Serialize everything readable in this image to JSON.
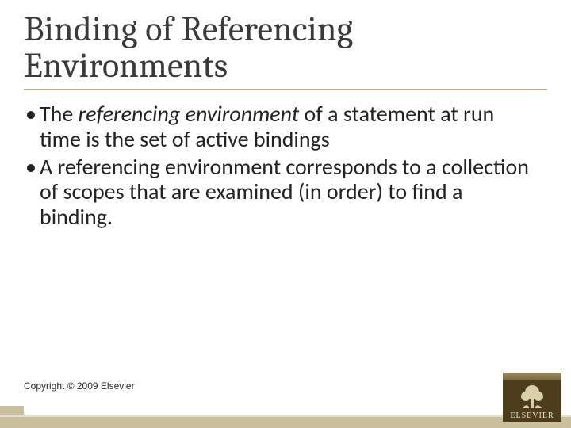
{
  "title": "Binding of Referencing Environments",
  "bullets": [
    {
      "pre": "The ",
      "italic": "referencing environment",
      "post": " of a statement at run time is the set of active bindings"
    },
    {
      "pre": "A referencing environment corresponds to a collection of scopes that are examined (in order) to find a binding.",
      "italic": "",
      "post": ""
    }
  ],
  "copyright": "Copyright © 2009 Elsevier",
  "logo": {
    "label": "ELSEVIER",
    "name": "elsevier-logo"
  }
}
